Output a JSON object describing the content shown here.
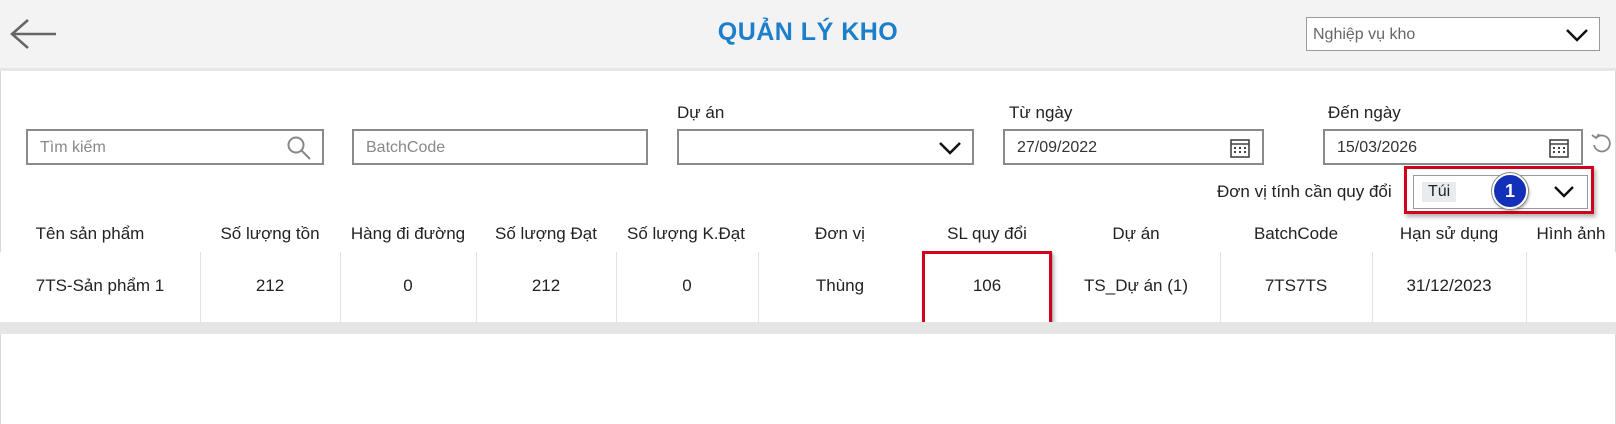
{
  "header": {
    "title": "QUẢN LÝ KHO",
    "nghiep_vu_select": "Nghiệp vụ kho"
  },
  "filters": {
    "search_placeholder": "Tìm kiếm",
    "batch_placeholder": "BatchCode",
    "du_an_label": "Dự án",
    "du_an_value": "",
    "tu_ngay_label": "Từ ngày",
    "tu_ngay_value": "27/09/2022",
    "den_ngay_label": "Đến ngày",
    "den_ngay_value": "15/03/2026",
    "don_vi_label": "Đơn vị tính cần quy đổi",
    "don_vi_value": "Túi",
    "badge_number": "1"
  },
  "table": {
    "columns": [
      "Tên sản phẩm",
      "Số lượng tồn",
      "Hàng đi đường",
      "Số lượng Đạt",
      "Số lượng K.Đạt",
      "Đơn vị",
      "SL quy đổi",
      "Dự án",
      "BatchCode",
      "Hạn sử dụng",
      "Hình ảnh"
    ],
    "rows": [
      [
        "7TS-Sản phẩm 1",
        "212",
        "0",
        "212",
        "0",
        "Thùng",
        "106",
        "TS_Dự án (1)",
        "7TS7TS",
        "31/12/2023",
        ""
      ]
    ]
  },
  "colors": {
    "title": "#1b7fcc",
    "highlight": "#d0021b",
    "badge": "#1230b8"
  }
}
